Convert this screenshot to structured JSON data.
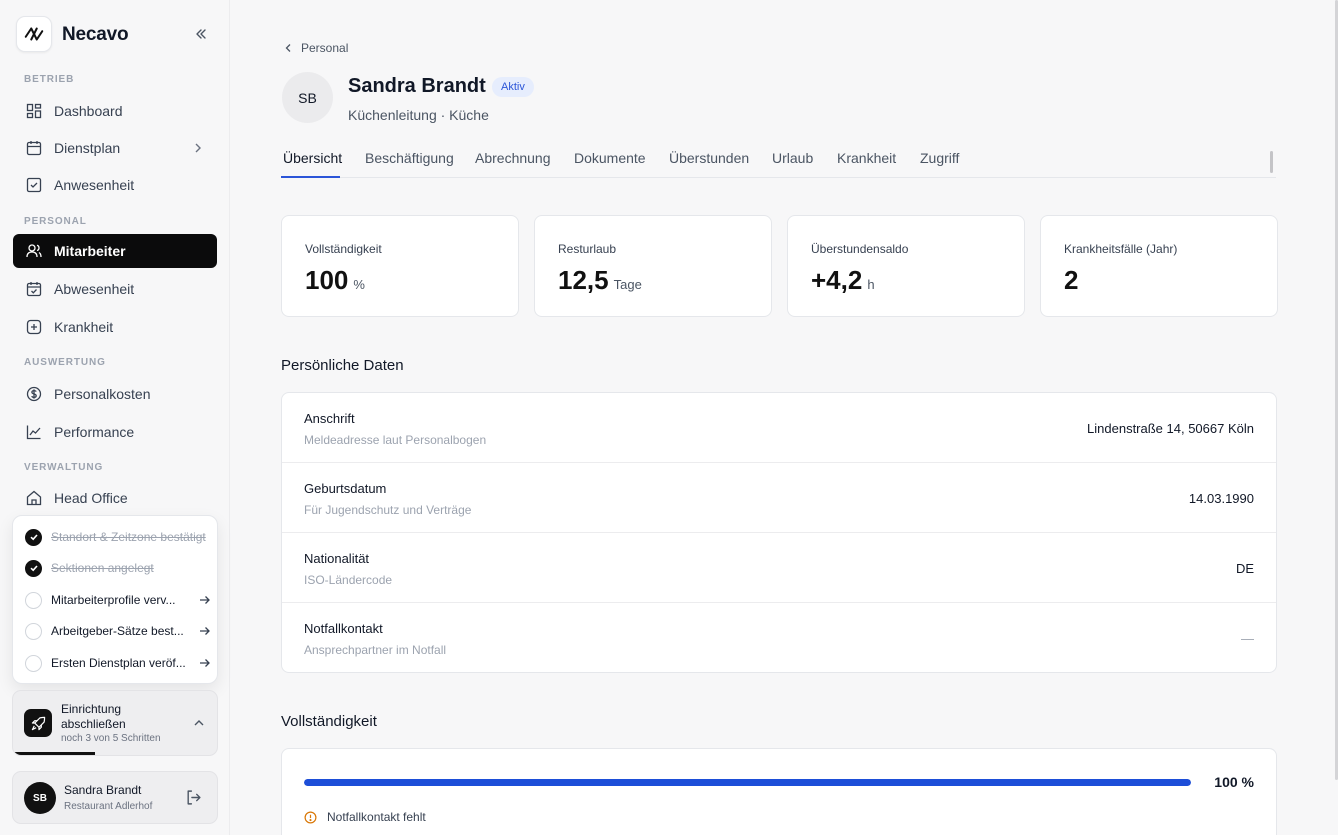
{
  "app": {
    "name": "Necavo"
  },
  "sidebar": {
    "sections": {
      "betrieb": "BETRIEB",
      "personal": "PERSONAL",
      "auswertung": "AUSWERTUNG",
      "verwaltung": "VERWALTUNG"
    },
    "items": [
      {
        "label": "Dashboard",
        "icon": "dashboard-grid-icon"
      },
      {
        "label": "Dienstplan",
        "icon": "calendar-icon"
      },
      {
        "label": "Anwesenheit",
        "icon": "calendar-check-icon"
      },
      {
        "label": "Mitarbeiter",
        "icon": "users-icon",
        "active": true
      },
      {
        "label": "Abwesenheit",
        "icon": "calendar-check-icon"
      },
      {
        "label": "Krankheit",
        "icon": "plus-square-icon"
      },
      {
        "label": "Personalkosten",
        "icon": "dollar-circle-icon"
      },
      {
        "label": "Performance",
        "icon": "line-chart-icon"
      },
      {
        "label": "Head Office",
        "icon": "building-icon"
      }
    ],
    "checklist": [
      {
        "label": "Standort & Zeitzone bestätigt",
        "done": true
      },
      {
        "label": "Sektionen angelegt",
        "done": true
      },
      {
        "label": "Mitarbeiterprofile verv...",
        "done": false
      },
      {
        "label": "Arbeitgeber-Sätze best...",
        "done": false
      },
      {
        "label": "Ersten Dienstplan veröf...",
        "done": false
      }
    ],
    "setup": {
      "title": "Einrichtung abschließen",
      "subtitle": "noch 3 von 5 Schritten",
      "progress_fraction": 0.4
    },
    "user": {
      "initials": "SB",
      "name": "Sandra Brandt",
      "location": "Restaurant Adlerhof"
    }
  },
  "breadcrumb": {
    "label": "Personal"
  },
  "profile": {
    "initials": "SB",
    "name": "Sandra Brandt",
    "status": "Aktiv",
    "role": "Küchenleitung · Küche"
  },
  "tabs": [
    "Übersicht",
    "Beschäftigung",
    "Abrechnung",
    "Dokumente",
    "Überstunden",
    "Urlaub",
    "Krankheit",
    "Zugriff"
  ],
  "stats": [
    {
      "label": "Vollständigkeit",
      "value": "100",
      "unit": "%"
    },
    {
      "label": "Resturlaub",
      "value": "12,5",
      "unit": "Tage"
    },
    {
      "label": "Überstundensaldo",
      "value": "+4,2",
      "unit": "h"
    },
    {
      "label": "Krankheitsfälle (Jahr)",
      "value": "2",
      "unit": ""
    }
  ],
  "personal_data": {
    "title": "Persönliche Daten",
    "rows": [
      {
        "label": "Anschrift",
        "sub": "Meldeadresse laut Personalbogen",
        "value": "Lindenstraße 14, 50667 Köln"
      },
      {
        "label": "Geburtsdatum",
        "sub": "Für Jugendschutz und Verträge",
        "value": "14.03.1990"
      },
      {
        "label": "Nationalität",
        "sub": "ISO-Ländercode",
        "value": "DE"
      },
      {
        "label": "Notfallkontakt",
        "sub": "Ansprechpartner im Notfall",
        "value": "—"
      }
    ]
  },
  "completeness": {
    "title": "Vollständigkeit",
    "percent_label": "100 %",
    "fraction": 1.0,
    "warning": "Notfallkontakt fehlt"
  },
  "colors": {
    "accent": "#2b55d8",
    "progress": "#1d4ed8",
    "active_nav_bg": "#0b0b0c",
    "warning": "#d97706"
  }
}
